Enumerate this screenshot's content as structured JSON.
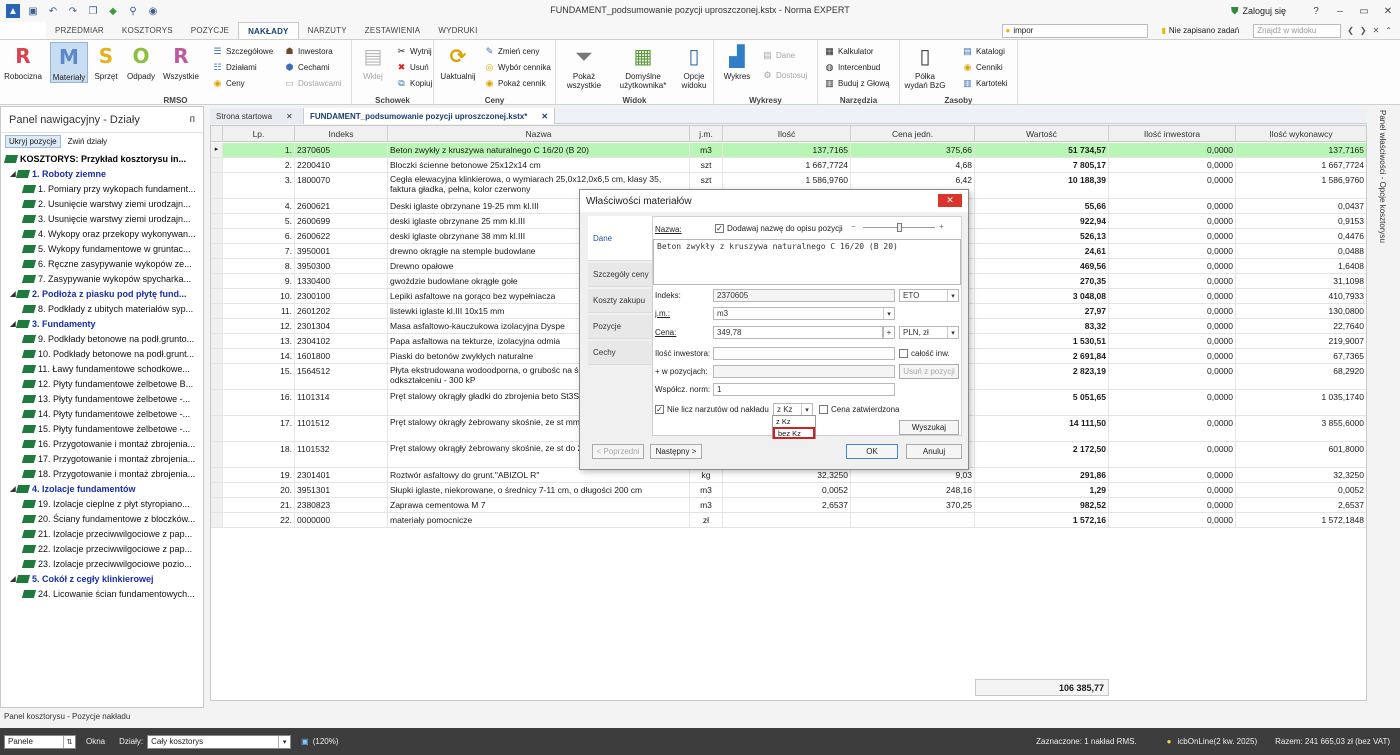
{
  "window": {
    "title": "FUNDAMENT_podsumowanie pozycji uproszczonej.kstx - Norma EXPERT",
    "login": "Zaloguj się",
    "controls": [
      "?",
      "–",
      "▭",
      "✕"
    ]
  },
  "ribbon_tabs": {
    "file": "",
    "items": [
      "PRZEDMIAR",
      "KOSZTORYS",
      "POZYCJE",
      "NAKŁADY",
      "NARZUTY",
      "ZESTAWIENIA",
      "WYDRUKI"
    ],
    "active_index": 3,
    "search_value": "impor",
    "unsaved": "Nie zapisano zadań",
    "find_placeholder": "Znajdź w widoku"
  },
  "ribbon": {
    "rmso": {
      "label": "RMSO",
      "buttons": [
        {
          "label": "Robocizna",
          "glyph": "R",
          "color": "#d9434b"
        },
        {
          "label": "Materiały",
          "glyph": "M",
          "color": "#5a88c9"
        },
        {
          "label": "Sprzęt",
          "glyph": "S",
          "color": "#e0b21e"
        },
        {
          "label": "Odpady",
          "glyph": "O",
          "color": "#8cbf3f"
        },
        {
          "label": "Wszystkie",
          "glyph": "R",
          "color": "#c05aa0"
        }
      ],
      "small": [
        "Szczegółowe",
        "Działami",
        "Ceny",
        "Inwestora",
        "Cechami",
        "Dostawcami"
      ]
    },
    "schowek": {
      "label": "Schowek",
      "big": "Wklej",
      "small": [
        "Wytnij",
        "Usuń",
        "Kopiuj"
      ]
    },
    "ceny": {
      "label": "Ceny",
      "big": "Uaktualnij",
      "small": [
        "Zmień ceny",
        "Wybór cennika",
        "Pokaż cennik"
      ]
    },
    "widok": {
      "label": "Widok",
      "big": [
        "Pokaż wszystkie",
        "Domyślne użytkownika*",
        "Opcje widoku"
      ]
    },
    "wykresy": {
      "label": "Wykresy",
      "big": "Wykres",
      "small": [
        "Dane",
        "Dostosuj"
      ]
    },
    "narzedzia": {
      "label": "Narzędzia",
      "small": [
        "Kalkulator",
        "Intercenbud",
        "Buduj z Głową"
      ]
    },
    "zasoby_big": "Półka wydań BzG",
    "zasoby": {
      "label": "Zasoby",
      "small": [
        "Katalogi",
        "Cenniki",
        "Kartoteki"
      ]
    }
  },
  "nav_panel": {
    "title": "Panel nawigacyjny - Działy",
    "pin": "ᴨ",
    "btn_hide": "Ukryj pozycje",
    "btn_collapse": "Zwiń działy",
    "tree": [
      {
        "level": 0,
        "type": "root",
        "text": "KOSZTORYS: Przykład kosztorysu in..."
      },
      {
        "level": 1,
        "type": "section",
        "text": "1. Roboty ziemne"
      },
      {
        "level": 2,
        "type": "item",
        "text": "1. Pomiary przy wykopach fundament..."
      },
      {
        "level": 2,
        "type": "item",
        "text": "2. Usunięcie warstwy ziemi urodzajn..."
      },
      {
        "level": 2,
        "type": "item",
        "text": "3. Usunięcie warstwy ziemi urodzajn..."
      },
      {
        "level": 2,
        "type": "item",
        "text": "4. Wykopy oraz przekopy wykonywan..."
      },
      {
        "level": 2,
        "type": "item",
        "text": "5. Wykopy fundamentowe  w gruntac..."
      },
      {
        "level": 2,
        "type": "item",
        "text": "6. Ręczne zasypywanie wykopów ze..."
      },
      {
        "level": 2,
        "type": "item",
        "text": "7. Zasypywanie wykopów spycharka..."
      },
      {
        "level": 1,
        "type": "section",
        "text": "2. Podłoża z piasku pod płytę fund..."
      },
      {
        "level": 2,
        "type": "item",
        "text": "8. Podkłady z ubitych materiałów syp..."
      },
      {
        "level": 1,
        "type": "section",
        "text": "3. Fundamenty"
      },
      {
        "level": 2,
        "type": "item",
        "text": "9. Podkłady betonowe na podł.grunto..."
      },
      {
        "level": 2,
        "type": "item",
        "text": "10. Podkłady betonowe na podł.grunt..."
      },
      {
        "level": 2,
        "type": "item",
        "text": "11. Ławy fundamentowe schodkowe..."
      },
      {
        "level": 2,
        "type": "item",
        "text": "12. Płyty fundamentowe żelbetowe B..."
      },
      {
        "level": 2,
        "type": "item",
        "text": "13. Płyty fundamentowe żelbetowe -..."
      },
      {
        "level": 2,
        "type": "item",
        "text": "14. Płyty fundamentowe żelbetowe -..."
      },
      {
        "level": 2,
        "type": "item",
        "text": "15. Płyty fundamentowe żelbetowe -..."
      },
      {
        "level": 2,
        "type": "item",
        "text": "16. Przygotowanie i montaż zbrojenia..."
      },
      {
        "level": 2,
        "type": "item",
        "text": "17. Przygotowanie i montaż zbrojenia..."
      },
      {
        "level": 2,
        "type": "item",
        "text": "18. Przygotowanie i montaż zbrojenia..."
      },
      {
        "level": 1,
        "type": "section",
        "text": "4. Izolacje fundamentów"
      },
      {
        "level": 2,
        "type": "item",
        "text": "19. Izolacje cieplne z płyt styropiano..."
      },
      {
        "level": 2,
        "type": "item",
        "text": "20. Ściany fundamentowe z bloczków..."
      },
      {
        "level": 2,
        "type": "item",
        "text": "21. Izolacje przeciwwilgociowe z pap..."
      },
      {
        "level": 2,
        "type": "item",
        "text": "22. Izolacje przeciwwilgociowe z pap..."
      },
      {
        "level": 2,
        "type": "item",
        "text": "23. Izolacje przeciwwilgociowe pozio..."
      },
      {
        "level": 1,
        "type": "section",
        "text": "5. Cokół z cegły klinkierowej"
      },
      {
        "level": 2,
        "type": "item",
        "text": "24. Licowanie ścian fundamentowych..."
      }
    ]
  },
  "doc_tabs": [
    {
      "label": "Strona startowa",
      "active": false
    },
    {
      "label": "FUNDAMENT_podsumowanie pozycji uproszczonej.kstx*",
      "active": true
    }
  ],
  "grid": {
    "columns": [
      "Lp.",
      "Indeks",
      "Nazwa",
      "j.m.",
      "Ilość",
      "Cena jedn.",
      "Wartość",
      "Ilość inwestora",
      "Ilość wykonawcy"
    ],
    "rows": [
      {
        "lp": "1.",
        "indeks": "2370605",
        "nazwa": "Beton zwykły z kruszywa naturalnego C 16/20 (B 20)",
        "jm": "m3",
        "ilosc": "137,7165",
        "cena": "375,66",
        "wartosc": "51 734,57",
        "inw": "0,0000",
        "wyk": "137,7165",
        "h": 15
      },
      {
        "lp": "2.",
        "indeks": "2200410",
        "nazwa": "Bloczki ścienne betonowe 25x12x14 cm",
        "jm": "szt",
        "ilosc": "1 667,7724",
        "cena": "4,68",
        "wartosc": "7 805,17",
        "inw": "0,0000",
        "wyk": "1 667,7724",
        "h": 15
      },
      {
        "lp": "3.",
        "indeks": "1800070",
        "nazwa": "Cegła elewacyjna klinkierowa, o wymiarach 25,0x12,0x6,5 cm, klasy 35, faktura gładka, pełna, kolor czerwony",
        "jm": "szt",
        "ilosc": "1 586,9760",
        "cena": "6,42",
        "wartosc": "10 188,39",
        "inw": "0,0000",
        "wyk": "1 586,9760",
        "h": 26
      },
      {
        "lp": "4.",
        "indeks": "2600621",
        "nazwa": "Deski iglaste obrzynane 19-25 mm kl.III",
        "jm": "",
        "ilosc": "",
        "cena": "",
        "wartosc": "55,66",
        "inw": "0,0000",
        "wyk": "0,0437",
        "h": 15
      },
      {
        "lp": "5.",
        "indeks": "2600699",
        "nazwa": "deski iglaste obrzynane 25 mm kl.III",
        "jm": "",
        "ilosc": "",
        "cena": "",
        "wartosc": "922,94",
        "inw": "0,0000",
        "wyk": "0,9153",
        "h": 15
      },
      {
        "lp": "6.",
        "indeks": "2600622",
        "nazwa": "deski iglaste obrzynane 38 mm kl.III",
        "jm": "",
        "ilosc": "",
        "cena": "",
        "wartosc": "526,13",
        "inw": "0,0000",
        "wyk": "0,4476",
        "h": 15
      },
      {
        "lp": "7.",
        "indeks": "3950001",
        "nazwa": "drewno okrągłe na stemple budowlane",
        "jm": "",
        "ilosc": "",
        "cena": "",
        "wartosc": "24,61",
        "inw": "0,0000",
        "wyk": "0,0488",
        "h": 15
      },
      {
        "lp": "8.",
        "indeks": "3950300",
        "nazwa": "Drewno opałowe",
        "jm": "",
        "ilosc": "",
        "cena": "",
        "wartosc": "469,56",
        "inw": "0,0000",
        "wyk": "1,6408",
        "h": 15
      },
      {
        "lp": "9.",
        "indeks": "1330400",
        "nazwa": "gwoździe budowlane okrągłe gołe",
        "jm": "",
        "ilosc": "",
        "cena": "",
        "wartosc": "270,35",
        "inw": "0,0000",
        "wyk": "31,1098",
        "h": 15
      },
      {
        "lp": "10.",
        "indeks": "2300100",
        "nazwa": "Lepiki asfaltowe na gorąco bez wypełniacza",
        "jm": "",
        "ilosc": "",
        "cena": "",
        "wartosc": "3 048,08",
        "inw": "0,0000",
        "wyk": "410,7933",
        "h": 15
      },
      {
        "lp": "11.",
        "indeks": "2601202",
        "nazwa": "listewki iglaste kl.III 10x15 mm",
        "jm": "",
        "ilosc": "",
        "cena": "",
        "wartosc": "27,97",
        "inw": "0,0000",
        "wyk": "130,0800",
        "h": 15
      },
      {
        "lp": "12.",
        "indeks": "2301304",
        "nazwa": "Masa asfaltowo-kauczukowa izolacyjna Dyspe",
        "jm": "",
        "ilosc": "",
        "cena": "",
        "wartosc": "83,32",
        "inw": "0,0000",
        "wyk": "22,7640",
        "h": 15
      },
      {
        "lp": "13.",
        "indeks": "2304102",
        "nazwa": "Papa asfaltowa na tekturze, izolacyjna odmia",
        "jm": "",
        "ilosc": "",
        "cena": "",
        "wartosc": "1 530,51",
        "inw": "0,0000",
        "wyk": "219,9007",
        "h": 15
      },
      {
        "lp": "14.",
        "indeks": "1601800",
        "nazwa": "Piaski do betonów zwykłych naturalne",
        "jm": "",
        "ilosc": "",
        "cena": "",
        "wartosc": "2 691,84",
        "inw": "0,0000",
        "wyk": "67,7365",
        "h": 15
      },
      {
        "lp": "15.",
        "indeks": "1564512",
        "nazwa": "Płyta ekstrudowana wodoodporna, o grubośc na ściskanie przy 10% odkształceniu - 300 kP",
        "jm": "",
        "ilosc": "",
        "cena": "",
        "wartosc": "2 823,19",
        "inw": "0,0000",
        "wyk": "68,2920",
        "h": 26
      },
      {
        "lp": "16.",
        "indeks": "1101314",
        "nazwa": "Pręt stalowy okrągły gładki do zbrojenia beto St3S",
        "jm": "",
        "ilosc": "",
        "cena": "",
        "wartosc": "5 051,65",
        "inw": "0,0000",
        "wyk": "1 035,1740",
        "h": 26
      },
      {
        "lp": "17.",
        "indeks": "1101512",
        "nazwa": "Pręt stalowy okrągły żebrowany skośnie, ze st mm",
        "jm": "",
        "ilosc": "",
        "cena": "",
        "wartosc": "14 111,50",
        "inw": "0,0000",
        "wyk": "3 855,6000",
        "h": 26
      },
      {
        "lp": "18.",
        "indeks": "1101532",
        "nazwa": "Pręt stalowy okrągły żebrowany skośnie, ze st do 25 mm",
        "jm": "",
        "ilosc": "",
        "cena": "",
        "wartosc": "2 172,50",
        "inw": "0,0000",
        "wyk": "601,8000",
        "h": 26
      },
      {
        "lp": "19.",
        "indeks": "2301401",
        "nazwa": "Roztwór asfaltowy do grunt.\"ABIZOL R\"",
        "jm": "kg",
        "ilosc": "32,3250",
        "cena": "9,03",
        "wartosc": "291,86",
        "inw": "0,0000",
        "wyk": "32,3250",
        "h": 15
      },
      {
        "lp": "20.",
        "indeks": "3951301",
        "nazwa": "Słupki iglaste, niekorowane, o średnicy 7-11 cm, o długości 200 cm",
        "jm": "m3",
        "ilosc": "0,0052",
        "cena": "248,16",
        "wartosc": "1,29",
        "inw": "0,0000",
        "wyk": "0,0052",
        "h": 15
      },
      {
        "lp": "21.",
        "indeks": "2380823",
        "nazwa": "Zaprawa cementowa M 7",
        "jm": "m3",
        "ilosc": "2,6537",
        "cena": "370,25",
        "wartosc": "982,52",
        "inw": "0,0000",
        "wyk": "2,6537",
        "h": 15
      },
      {
        "lp": "22.",
        "indeks": "0000000",
        "nazwa": "materiały pomocnicze",
        "jm": "zł",
        "ilosc": "",
        "cena": "",
        "wartosc": "1 572,16",
        "inw": "0,0000",
        "wyk": "1 572,1848",
        "h": 15
      }
    ],
    "total": "106 385,77"
  },
  "right_strip": "Panel właściwości - Opcje kosztorysu",
  "bottom_panel_label": "Panel kosztorysu - Pozycje nakładu",
  "status": {
    "panel_select": "Panele",
    "okna": "Okna",
    "dzialy_label": "Działy:",
    "dzialy_value": "Cały kosztorys",
    "zoom": "(120%)",
    "zaznaczone": "Zaznaczone: 1 nakład RMS.",
    "icb": "icbOnLine(2 kw. 2025)",
    "razem": "Razem: 241 665,03 zł (bez VAT)"
  },
  "dialog": {
    "title": "Właściwości materiałów",
    "close": "✕",
    "side_tabs": [
      "Dane",
      "Szczegóły ceny",
      "Koszty zakupu",
      "Pozycje",
      "Cechy"
    ],
    "nazwa_label": "Nazwa:",
    "add_name_label": "Dodawaj nazwę do opisu pozycji",
    "nazwa_value": "Beton zwykły z kruszywa naturalnego C 16/20 (B 20)",
    "indeks_label": "Indeks:",
    "indeks_value": "2370605",
    "indeks_src": "ETO",
    "jm_label": "j.m.:",
    "jm_value": "m3",
    "cena_label": "Cena:",
    "cena_value": "349,78",
    "cena_plus": "+",
    "currency": "PLN, zł",
    "ilosc_inw_label": "Ilość inwestora:",
    "calosc_label": "całość inw.",
    "wpoz_label": "+ w pozycjach:",
    "usun_label": "Usuń z pozycji",
    "wspol_label": "Współcz. norm:",
    "wspol_value": "1",
    "nielicz_label": "Nie licz narzutów od nakładu",
    "kz_value": "z Kz",
    "kz_options": [
      "z Kz",
      "bez Kz"
    ],
    "cena_zatw_label": "Cena zatwierdzona",
    "wyszukaj": "Wyszukaj",
    "prev": "< Poprzedni",
    "next": "Następny >",
    "ok": "OK",
    "cancel": "Anuluj"
  }
}
